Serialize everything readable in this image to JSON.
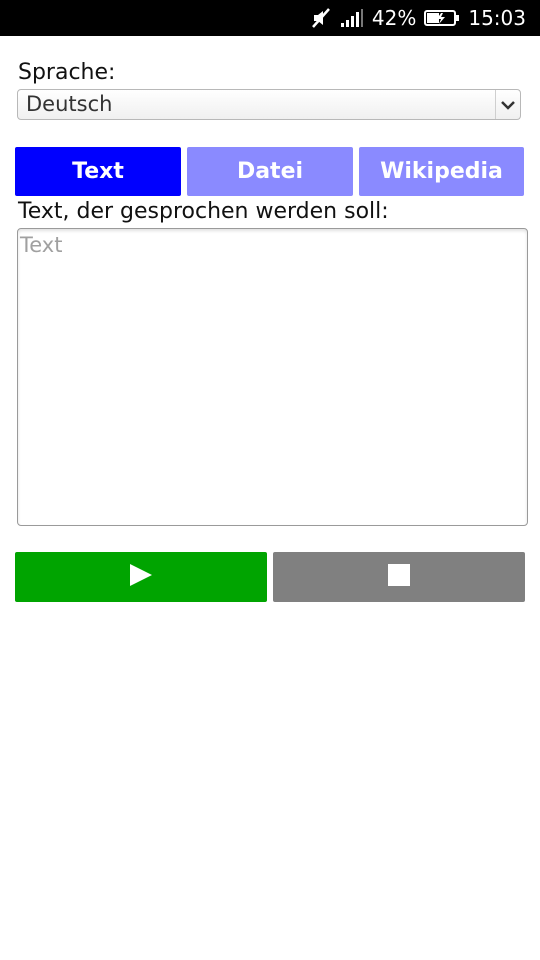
{
  "status_bar": {
    "battery_percent": "42%",
    "time": "15:03",
    "icons": [
      "mute-icon",
      "signal-icon",
      "battery-charging-icon"
    ]
  },
  "language": {
    "label": "Sprache:",
    "selected": "Deutsch"
  },
  "tabs": [
    {
      "label": "Text",
      "active": true
    },
    {
      "label": "Datei",
      "active": false
    },
    {
      "label": "Wikipedia",
      "active": false
    }
  ],
  "text_input": {
    "label": "Text, der gesprochen werden soll:",
    "placeholder": "Text",
    "value": ""
  },
  "controls": {
    "play_icon": "play-icon",
    "stop_icon": "stop-icon"
  },
  "colors": {
    "active_tab": "#0000ff",
    "inactive_tab": "#8a8aff",
    "play_button": "#00a400",
    "stop_button": "#808080",
    "status_bar": "#000000"
  }
}
